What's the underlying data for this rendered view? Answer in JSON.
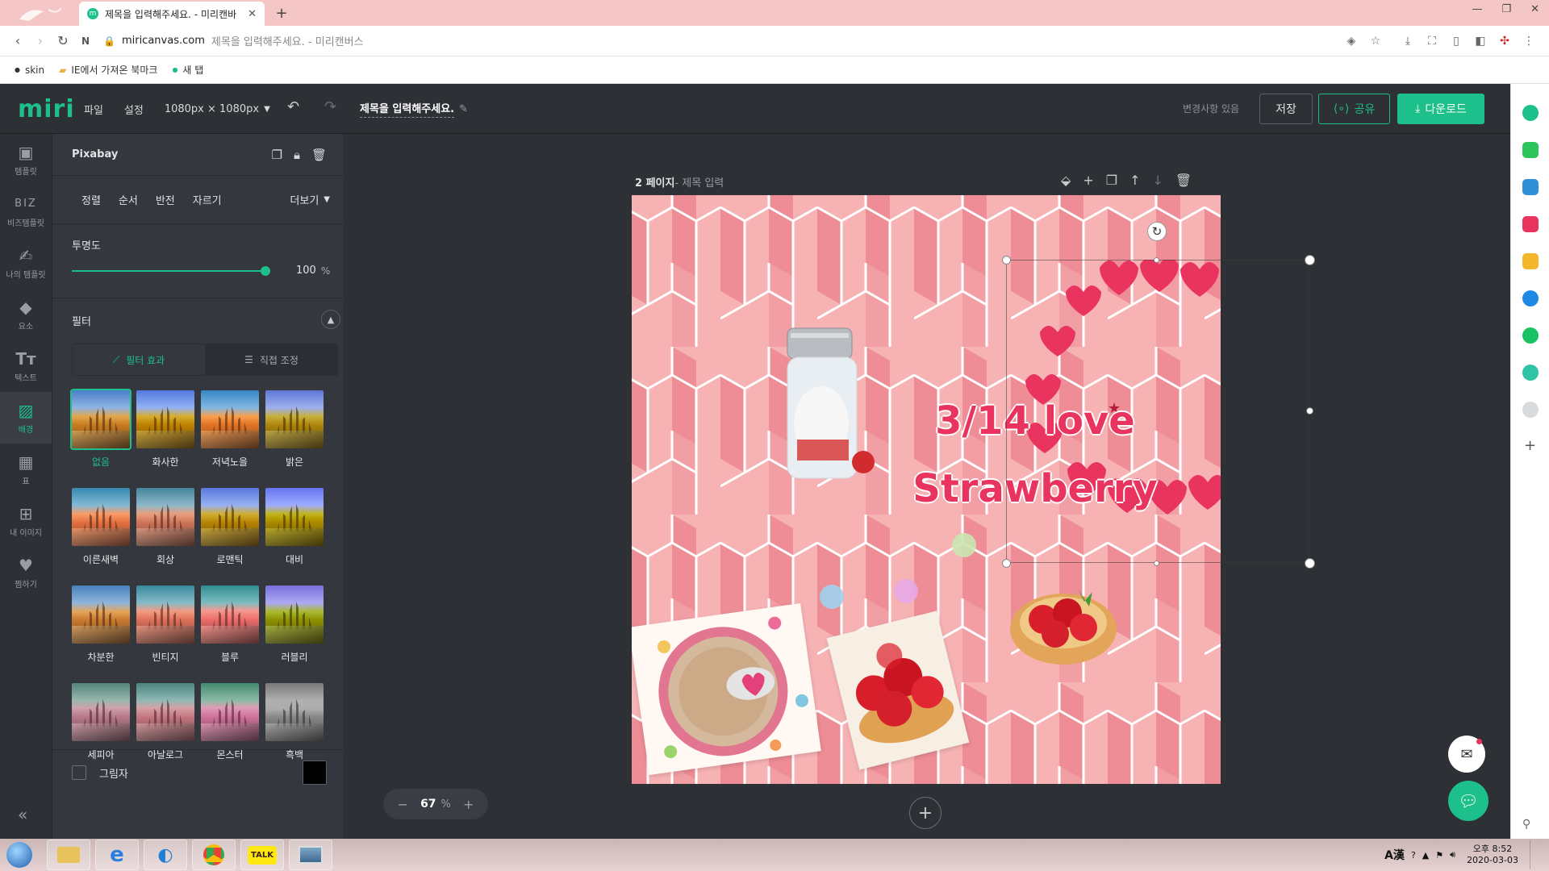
{
  "browser": {
    "tab_title": "제목을 입력해주세요. - 미리캔바",
    "new_tab_glyph": "+",
    "url_domain": "miricanvas.com",
    "url_page_title": " 제목을 입력해주세요. - 미리캔버스",
    "bookmarks": [
      "skin",
      "IE에서 가져온 북마크",
      "새 탭"
    ]
  },
  "header": {
    "logo": "miri",
    "menu": [
      "파일",
      "설정"
    ],
    "size_label": "1080px × 1080px",
    "doc_title": "제목을 입력해주세요.",
    "status": "변경사항 있음",
    "save_label": "저장",
    "share_label": "공유",
    "download_label": "다운로드"
  },
  "rail": [
    {
      "icon": "template-icon",
      "label": "템플릿"
    },
    {
      "icon": "biz-icon",
      "label": "비즈템플릿"
    },
    {
      "icon": "my-template-icon",
      "label": "나의 템플릿"
    },
    {
      "icon": "elements-icon",
      "label": "요소"
    },
    {
      "icon": "text-icon",
      "label": "텍스트"
    },
    {
      "icon": "background-icon",
      "label": "배경",
      "active": true
    },
    {
      "icon": "table-icon",
      "label": "표"
    },
    {
      "icon": "my-images-icon",
      "label": "내 이미지"
    },
    {
      "icon": "heart-icon",
      "label": "찜하기"
    }
  ],
  "panel": {
    "source": "Pixabay",
    "actions": [
      "정렬",
      "순서",
      "반전",
      "자르기"
    ],
    "more_label": "더보기",
    "opacity_label": "투명도",
    "opacity_value": "100",
    "opacity_unit": "%",
    "opacity_level": 100,
    "filter_label": "필터",
    "filter_tabs": [
      "필터 효과",
      "직접 조정"
    ],
    "filters": [
      "없음",
      "화사한",
      "저녁노을",
      "밝은",
      "이른새벽",
      "회상",
      "로맨틱",
      "대비",
      "차분한",
      "빈티지",
      "블루",
      "러블리",
      "세피아",
      "아날로그",
      "몬스터",
      "흑백"
    ],
    "selected_filter": "없음",
    "shadow_label": "그림자",
    "collapse_glyph": "«"
  },
  "page": {
    "page_number": "2 페이지",
    "page_title": " - 제목 입력",
    "canvas_text_line1": "3/14 love",
    "canvas_text_line2": "Strawberry"
  },
  "zoom": {
    "minus": "−",
    "value": "67",
    "unit": "%",
    "plus": "+"
  },
  "taskbar": {
    "time": "오후 8:52",
    "date": "2020-03-03",
    "kakao_label": "TALK",
    "ime_label": "A漢"
  },
  "colors": {
    "accent": "#1dbf8a",
    "canvas_bg": "#f7b3b4",
    "text_pink": "#e8345e"
  }
}
